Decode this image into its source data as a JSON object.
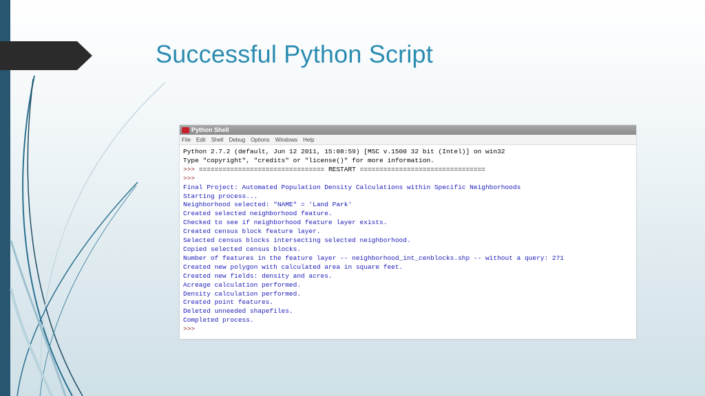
{
  "slide": {
    "title": "Successful Python Script"
  },
  "window": {
    "title": "Python Shell",
    "menu": [
      "File",
      "Edit",
      "Shell",
      "Debug",
      "Options",
      "Windows",
      "Help"
    ]
  },
  "console": {
    "lines": [
      {
        "type": "black",
        "text": "Python 2.7.2 (default, Jun 12 2011, 15:08:59) [MSC v.1500 32 bit (Intel)] on win32"
      },
      {
        "type": "black",
        "text": "Type \"copyright\", \"credits\" or \"license()\" for more information."
      },
      {
        "type": "prompt",
        "prompt": ">>> ",
        "text": "================================ RESTART ================================"
      },
      {
        "type": "prompt",
        "prompt": ">>>",
        "text": ""
      },
      {
        "type": "blue",
        "text": "Final Project: Automated Population Density Calculations within Specific Neighborhoods"
      },
      {
        "type": "blue",
        "text": "Starting process..."
      },
      {
        "type": "blue",
        "text": "Neighborhood selected: \"NAME\" = 'Land Park'"
      },
      {
        "type": "blue",
        "text": "Created selected neighborhood feature."
      },
      {
        "type": "blue",
        "text": "Checked to see if neighborhood feature layer exists."
      },
      {
        "type": "blue",
        "text": "Created census block feature layer."
      },
      {
        "type": "blue",
        "text": "Selected census blocks intersecting selected neighborhood."
      },
      {
        "type": "blue",
        "text": "Copied selected census blocks."
      },
      {
        "type": "blue",
        "text": "Number of features in the feature layer -- neighborhood_int_cenblocks.shp -- without a query: 271"
      },
      {
        "type": "blue",
        "text": "Created new polygon with calculated area in square feet."
      },
      {
        "type": "blue",
        "text": "Created new fields: density and acres."
      },
      {
        "type": "blue",
        "text": "Acreage calculation performed."
      },
      {
        "type": "blue",
        "text": "Density calculation performed."
      },
      {
        "type": "blue",
        "text": "Created point features."
      },
      {
        "type": "blue",
        "text": "Deleted unneeded shapefiles."
      },
      {
        "type": "blue",
        "text": "Completed process."
      },
      {
        "type": "prompt",
        "prompt": ">>>",
        "text": ""
      }
    ]
  },
  "colors": {
    "title": "#2a8bb0",
    "left_bar": "#285670",
    "arrow": "#2b2b2b",
    "output_blue": "#1a1ab8",
    "prompt": "#8b1a1a"
  },
  "icons": {
    "app": "python-idle-icon"
  }
}
